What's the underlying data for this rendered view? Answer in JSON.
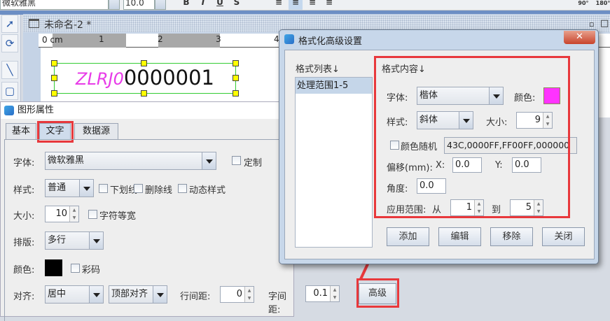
{
  "toolbar": {
    "font": "微软雅黑",
    "size": "10.0",
    "bold": "B",
    "italic": "I",
    "underline": "U",
    "strike": "S",
    "rot90": "90°",
    "rot180": "180°"
  },
  "document": {
    "title": "未命名-2 *",
    "ruler_unit": "0 cm",
    "ruler_ticks": [
      "1",
      "2",
      "3",
      "4"
    ],
    "barcode_text_prefix": "ZLRJ0",
    "barcode_text_rest": "0000001"
  },
  "properties": {
    "title": "图形属性",
    "tabs": [
      "基本",
      "文字",
      "数据源"
    ],
    "font_label": "字体:",
    "font_value": "微软雅黑",
    "custom_label": "定制",
    "style_label": "样式:",
    "style_value": "普通",
    "underline": "下划线",
    "strikethrough": "删除线",
    "dynamic_style": "动态样式",
    "size_label": "大小:",
    "size_value": "10",
    "mono_width": "字符等宽",
    "layout_label": "排版:",
    "layout_value": "多行",
    "color_label": "颜色:",
    "color_value": "#000000",
    "color_code": "彩码",
    "align_label": "对齐:",
    "align_h": "居中",
    "align_v": "顶部对齐",
    "line_spacing_label": "行间距:",
    "line_spacing": "0",
    "char_spacing_label": "字间距:",
    "char_spacing": "0.1",
    "advanced_button": "高级"
  },
  "dialog": {
    "title": "格式化高级设置",
    "list_label": "格式列表↓",
    "list_items": [
      "处理范围1-5"
    ],
    "content_label": "格式内容↓",
    "font_label": "字体:",
    "font_value": "楷体",
    "color_label": "颜色:",
    "color_value": "#ff33ff",
    "style_label": "样式:",
    "style_value": "斜体",
    "size_label": "大小:",
    "size_value": "9",
    "random_color_label": "颜色随机",
    "random_color_value": "43C,0000FF,FF00FF,000000",
    "offset_label": "偏移(mm):",
    "x_label": "X:",
    "x_value": "0.0",
    "y_label": "Y:",
    "y_value": "0.0",
    "angle_label": "角度:",
    "angle_value": "0.0",
    "range_label": "应用范围:",
    "from_label": "从",
    "from_value": "1",
    "to_label": "到",
    "to_value": "5",
    "buttons": [
      "添加",
      "编辑",
      "移除",
      "关闭"
    ]
  }
}
